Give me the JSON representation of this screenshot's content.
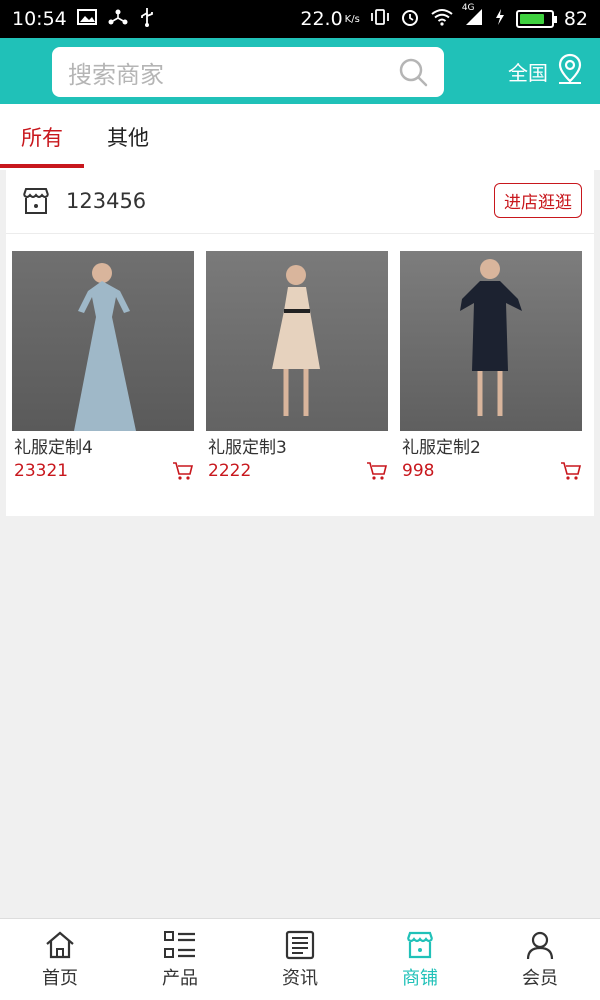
{
  "status_bar": {
    "time": "10:54",
    "speed": "22.0",
    "speed_unit": "K/s",
    "network": "4G",
    "battery": "82",
    "battery_level": 0.82,
    "icons": [
      "image-icon",
      "usb-icon",
      "vibrate-icon",
      "alarm-icon",
      "wifi-icon",
      "signal-icon",
      "charging-icon",
      "battery-icon"
    ]
  },
  "header": {
    "search_placeholder": "搜索商家",
    "region_label": "全国",
    "accent_color": "#20c1b8"
  },
  "tabs": [
    {
      "label": "所有",
      "active": true
    },
    {
      "label": "其他",
      "active": false
    }
  ],
  "store": {
    "name": "123456",
    "enter_label": "进店逛逛",
    "products": [
      {
        "title": "礼服定制4",
        "price": "23321",
        "dress_color": "#9fb8c8"
      },
      {
        "title": "礼服定制3",
        "price": "2222",
        "dress_color": "#e6d2be"
      },
      {
        "title": "礼服定制2",
        "price": "998",
        "dress_color": "#1c2230"
      }
    ]
  },
  "bottom_nav": [
    {
      "label": "首页",
      "icon": "home-icon",
      "active": false
    },
    {
      "label": "产品",
      "icon": "list-icon",
      "active": false
    },
    {
      "label": "资讯",
      "icon": "news-icon",
      "active": false
    },
    {
      "label": "商铺",
      "icon": "store-icon",
      "active": true
    },
    {
      "label": "会员",
      "icon": "user-icon",
      "active": false
    }
  ],
  "colors": {
    "brand": "#20c1b8",
    "accent_red": "#c8171d"
  }
}
